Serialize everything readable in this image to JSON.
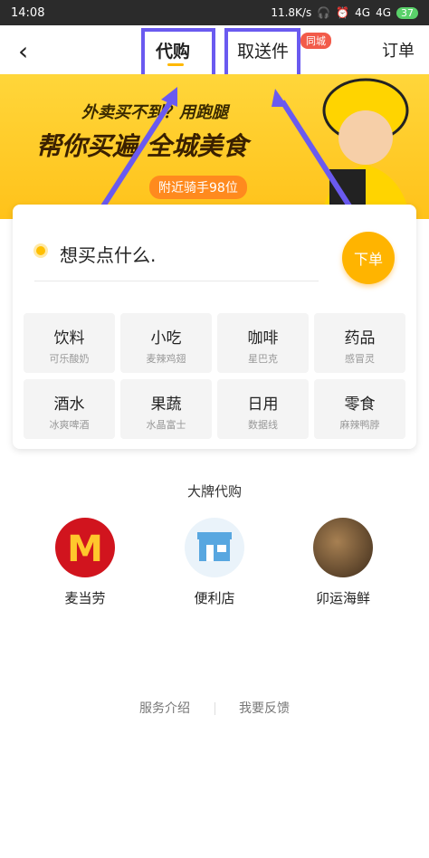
{
  "status_bar": {
    "time": "14:08",
    "speed": "11.8K/s",
    "net1": "4G",
    "net2": "4G",
    "battery": "37"
  },
  "header": {
    "tab_active": "代购",
    "tab2": "取送件",
    "badge": "同城",
    "right": "订单"
  },
  "banner": {
    "line1": "外卖买不到？用跑腿",
    "line2": "帮你买遍 全城美食",
    "rider": "附近骑手98位"
  },
  "card": {
    "prompt": "想买点什么.",
    "order_button": "下单",
    "categories": [
      {
        "name": "饮料",
        "sub": "可乐酸奶"
      },
      {
        "name": "小吃",
        "sub": "麦辣鸡翅"
      },
      {
        "name": "咖啡",
        "sub": "星巴克"
      },
      {
        "name": "药品",
        "sub": "感冒灵"
      },
      {
        "name": "酒水",
        "sub": "冰爽啤酒"
      },
      {
        "name": "果蔬",
        "sub": "水晶富士"
      },
      {
        "name": "日用",
        "sub": "数据线"
      },
      {
        "name": "零食",
        "sub": "麻辣鸭脖"
      }
    ]
  },
  "brands": {
    "title": "大牌代购",
    "items": [
      "麦当劳",
      "便利店",
      "卯运海鲜"
    ]
  },
  "footer": {
    "intro": "服务介绍",
    "feedback": "我要反馈"
  },
  "accent": "#ffb800",
  "highlight": "#6a5af0"
}
